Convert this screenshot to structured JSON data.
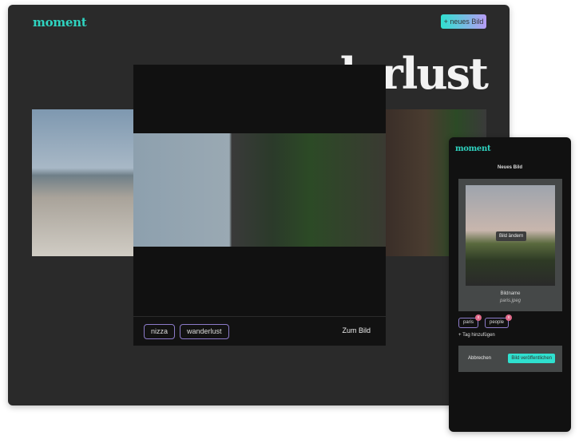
{
  "main": {
    "logo": "moment",
    "new_button": "+ neues Bild",
    "title": "wanderlust"
  },
  "modal": {
    "tags": [
      "nizza",
      "wanderlust"
    ],
    "open_link": "Zum Bild"
  },
  "phone": {
    "logo": "moment",
    "heading": "Neues Bild",
    "change_image": "Bild ändern",
    "name_label": "Bildname",
    "file_name": "paris.jpeg",
    "tags": [
      "paris",
      "people"
    ],
    "remove_tag": "x",
    "add_tag": "+ Tag hinzufügen",
    "cancel": "Abbrechen",
    "publish": "Bild veröffentlichen"
  },
  "colors": {
    "accent": "#2fd3c0",
    "tag_border": "#8c7bc9",
    "remove_badge": "#e06a8a"
  }
}
